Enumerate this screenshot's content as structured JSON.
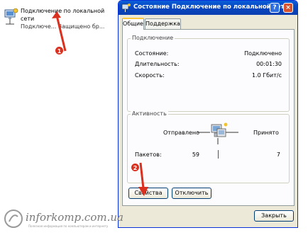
{
  "desktop_item": {
    "name_line1": "Подключение по локальной",
    "name_line2": "сети",
    "status": "Подключе... Защищено бр..."
  },
  "dialog": {
    "title": "Состояние Подключение по локальной сети",
    "help_label": "?",
    "close_label": "×",
    "tabs": [
      {
        "label": "Общие",
        "active": true
      },
      {
        "label": "Поддержка",
        "active": false
      }
    ],
    "connection": {
      "heading": "Подключение",
      "rows": [
        {
          "label": "Состояние:",
          "value": "Подключено"
        },
        {
          "label": "Длительность:",
          "value": "00:01:30"
        },
        {
          "label": "Скорость:",
          "value": "1.0 Гбит/с"
        }
      ]
    },
    "activity": {
      "heading": "Активность",
      "sent_label": "Отправлено",
      "received_label": "Принято",
      "packets_label": "Пакетов:",
      "packets_sent": "59",
      "packets_received": "7"
    },
    "buttons": {
      "properties": "Свойства",
      "disable": "Отключить",
      "close": "Закрыть"
    }
  },
  "annotations": {
    "marker1": "1",
    "marker2": "2",
    "arrow_color": "#d9301f"
  },
  "watermark": {
    "site": "inforkomp.com.ua",
    "tagline": "Полезная информация по компьютерам и интернету"
  },
  "colors": {
    "titlebar": "#0a4fc8",
    "dialog_bg": "#ece9d8",
    "panel_bg": "#fcfcfe",
    "tab_highlight": "#ffc83c"
  }
}
